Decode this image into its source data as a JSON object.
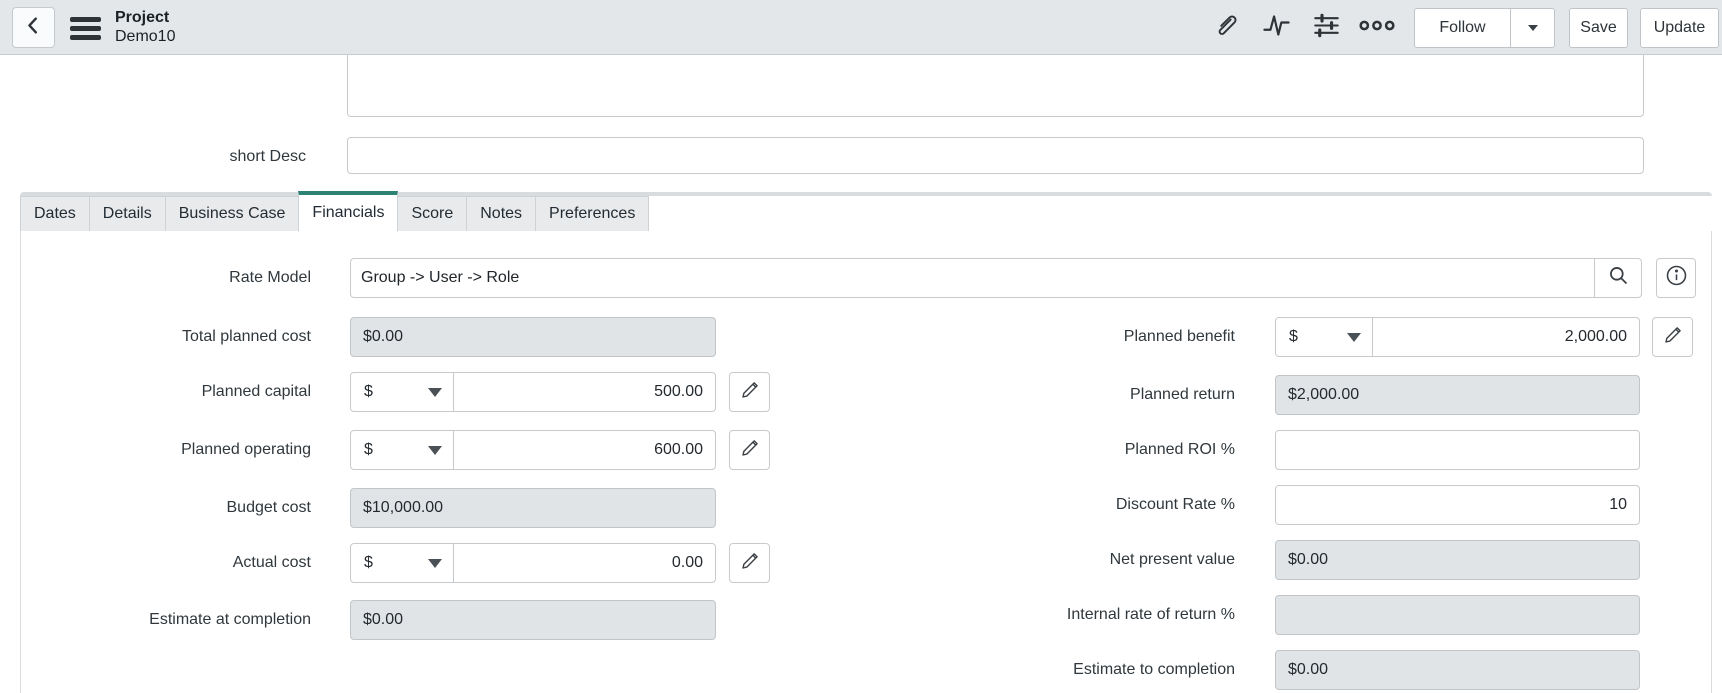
{
  "header": {
    "title": "Project",
    "record": "Demo10",
    "actions": {
      "follow": "Follow",
      "save": "Save",
      "update": "Update"
    }
  },
  "form": {
    "description": {
      "value": ""
    },
    "short_desc": {
      "label": "short Desc",
      "value": ""
    },
    "tabs": [
      "Dates",
      "Details",
      "Business Case",
      "Financials",
      "Score",
      "Notes",
      "Preferences"
    ],
    "active_tab": "Financials",
    "financials": {
      "rate_model": {
        "label": "Rate Model",
        "value": "Group -> User -> Role"
      },
      "left_rows": [
        {
          "label": "Total planned cost",
          "value": "$0.00",
          "readonly": true
        },
        {
          "label": "Planned capital",
          "currency": "$",
          "value": "500.00"
        },
        {
          "label": "Planned operating",
          "currency": "$",
          "value": "600.00"
        },
        {
          "label": "Budget cost",
          "value": "$10,000.00",
          "readonly": true
        },
        {
          "label": "Actual cost",
          "currency": "$",
          "value": "0.00"
        },
        {
          "label": "Estimate at completion",
          "value": "$0.00",
          "readonly": true
        }
      ],
      "right_rows": [
        {
          "label": "Planned benefit",
          "currency": "$",
          "value": "2,000.00"
        },
        {
          "label": "Planned return",
          "value": "$2,000.00",
          "readonly": true
        },
        {
          "label": "Planned ROI %",
          "value": ""
        },
        {
          "label": "Discount Rate %",
          "value": "10"
        },
        {
          "label": "Net present value",
          "value": "$0.00",
          "readonly": true
        },
        {
          "label": "Internal rate of return %",
          "value": "",
          "readonly": true
        },
        {
          "label": "Estimate to completion",
          "value": "$0.00",
          "readonly": true
        }
      ]
    }
  },
  "colors": {
    "accent_teal": "#2e8274",
    "header_bg": "#e4e7e9",
    "readonly_bg": "#e1e4e6"
  }
}
